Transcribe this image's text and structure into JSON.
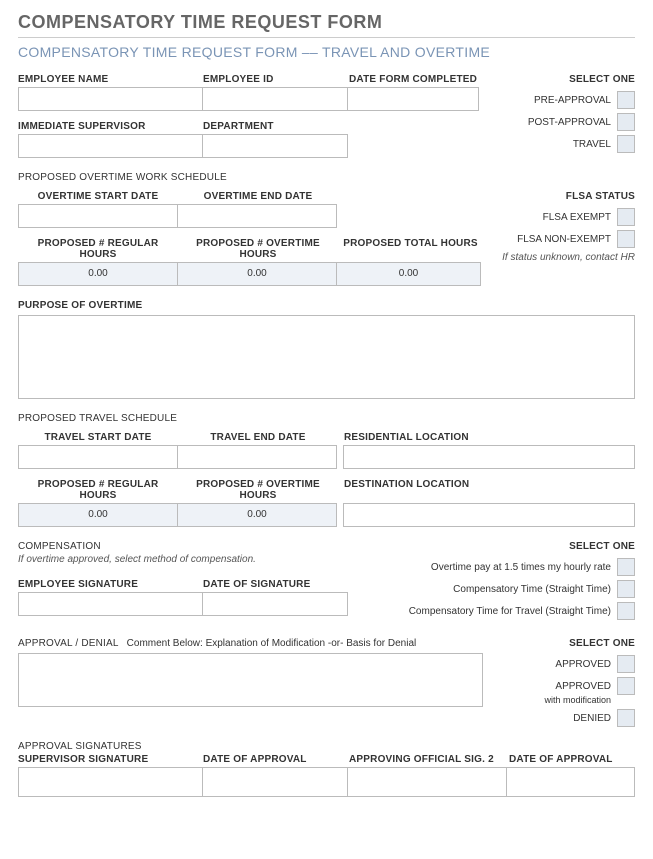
{
  "title": "COMPENSATORY TIME REQUEST FORM",
  "subtitle": "COMPENSATORY TIME REQUEST FORM –– TRAVEL AND OVERTIME",
  "emp": {
    "name_label": "EMPLOYEE NAME",
    "id_label": "EMPLOYEE ID",
    "date_label": "DATE FORM COMPLETED",
    "supervisor_label": "IMMEDIATE SUPERVISOR",
    "department_label": "DEPARTMENT"
  },
  "select_one": "SELECT ONE",
  "approval_type": {
    "pre": "PRE-APPROVAL",
    "post": "POST-APPROVAL",
    "travel": "TRAVEL"
  },
  "overtime": {
    "heading": "PROPOSED OVERTIME WORK SCHEDULE",
    "start_label": "OVERTIME START DATE",
    "end_label": "OVERTIME END DATE",
    "reg_label": "PROPOSED # REGULAR HOURS",
    "ot_label": "PROPOSED # OVERTIME HOURS",
    "total_label": "PROPOSED TOTAL HOURS",
    "reg_val": "0.00",
    "ot_val": "0.00",
    "total_val": "0.00"
  },
  "flsa": {
    "heading": "FLSA STATUS",
    "exempt": "FLSA EXEMPT",
    "nonexempt": "FLSA NON-EXEMPT",
    "note": "If status unknown, contact HR"
  },
  "purpose": {
    "label": "PURPOSE OF OVERTIME"
  },
  "travel": {
    "heading": "PROPOSED TRAVEL SCHEDULE",
    "start_label": "TRAVEL START DATE",
    "end_label": "TRAVEL END DATE",
    "res_label": "RESIDENTIAL LOCATION",
    "reg_label": "PROPOSED # REGULAR HOURS",
    "ot_label": "PROPOSED # OVERTIME HOURS",
    "dest_label": "DESTINATION LOCATION",
    "reg_val": "0.00",
    "ot_val": "0.00"
  },
  "comp": {
    "heading": "COMPENSATION",
    "note": "If overtime approved, select method of compensation.",
    "opt1": "Overtime pay at 1.5 times my hourly rate",
    "opt2": "Compensatory Time (Straight Time)",
    "opt3": "Compensatory Time for Travel (Straight Time)",
    "sig_label": "EMPLOYEE SIGNATURE",
    "sig_date_label": "DATE OF SIGNATURE"
  },
  "approval": {
    "heading": "APPROVAL / DENIAL",
    "note": "Comment Below: Explanation of Modification -or- Basis for Denial",
    "approved": "APPROVED",
    "approved_mod": "APPROVED",
    "approved_mod_sub": "with modification",
    "denied": "DENIED"
  },
  "sigs": {
    "heading": "APPROVAL SIGNATURES",
    "sup_label": "SUPERVISOR SIGNATURE",
    "date1_label": "DATE OF APPROVAL",
    "off2_label": "APPROVING OFFICIAL SIG. 2",
    "date2_label": "DATE OF APPROVAL"
  }
}
